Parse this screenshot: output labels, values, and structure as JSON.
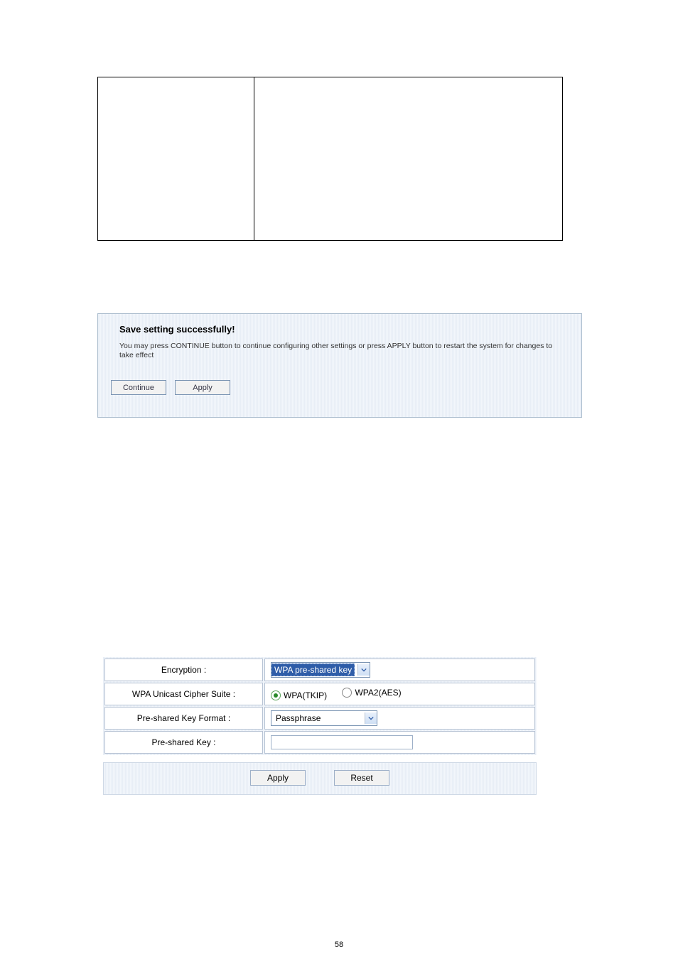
{
  "top_boxes": {
    "col1": "",
    "col2": ""
  },
  "save_panel": {
    "title": "Save setting successfully!",
    "message": "You may press CONTINUE button to continue configuring other settings or press APPLY button to restart the system for changes to take effect",
    "continue_label": "Continue",
    "apply_label": "Apply"
  },
  "cfg": {
    "rows": [
      {
        "label": "Encryption :"
      },
      {
        "label": "WPA Unicast Cipher Suite :"
      },
      {
        "label": "Pre-shared Key Format :"
      },
      {
        "label": "Pre-shared Key :"
      }
    ],
    "encryption_value": "WPA pre-shared key",
    "cipher": {
      "opt1": "WPA(TKIP)",
      "opt2": "WPA2(AES)",
      "selected": "WPA(TKIP)"
    },
    "psk_format_value": "Passphrase",
    "psk_value": "",
    "apply_label": "Apply",
    "reset_label": "Reset"
  },
  "page_number": "58"
}
